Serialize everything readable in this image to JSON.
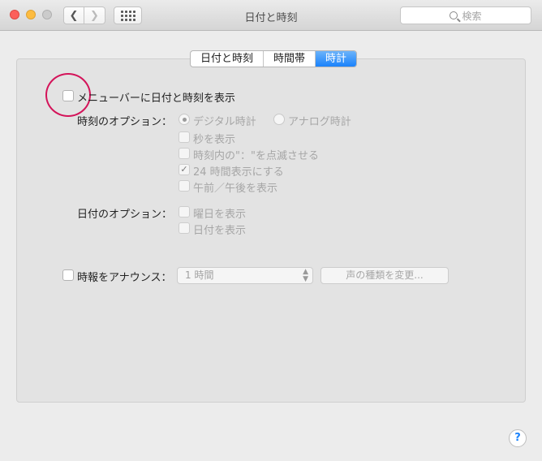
{
  "window": {
    "title": "日付と時刻"
  },
  "toolbar": {
    "back_icon": "chevron-left",
    "forward_icon": "chevron-right",
    "grid_icon": "show-all-grid"
  },
  "search": {
    "placeholder": "検索"
  },
  "tabs": [
    {
      "label": "日付と時刻",
      "active": false
    },
    {
      "label": "時間帯",
      "active": false
    },
    {
      "label": "時計",
      "active": true
    }
  ],
  "menubar_option": {
    "label": "メニューバーに日付と時刻を表示",
    "checked": false
  },
  "time_options": {
    "heading": "時刻のオプション：",
    "digital": {
      "label": "デジタル時計",
      "selected": true
    },
    "analog": {
      "label": "アナログ時計",
      "selected": false
    },
    "show_seconds": {
      "label": "秒を表示",
      "checked": false
    },
    "flash_separators": {
      "label": "時刻内の\"：\"を点滅させる",
      "checked": false
    },
    "use_24h": {
      "label": "24 時間表示にする",
      "checked": true,
      "mark": "✓"
    },
    "show_ampm": {
      "label": "午前／午後を表示",
      "checked": false
    }
  },
  "date_options": {
    "heading": "日付のオプション：",
    "show_weekday": {
      "label": "曜日を表示",
      "checked": false
    },
    "show_date": {
      "label": "日付を表示",
      "checked": false
    }
  },
  "announce": {
    "label": "時報をアナウンス：",
    "checked": false,
    "interval": "1 時間",
    "voice_button": "声の種類を変更..."
  },
  "help": {
    "label": "?"
  },
  "colors": {
    "accent": "#1a82fb",
    "highlight_circle": "#d4145a"
  }
}
